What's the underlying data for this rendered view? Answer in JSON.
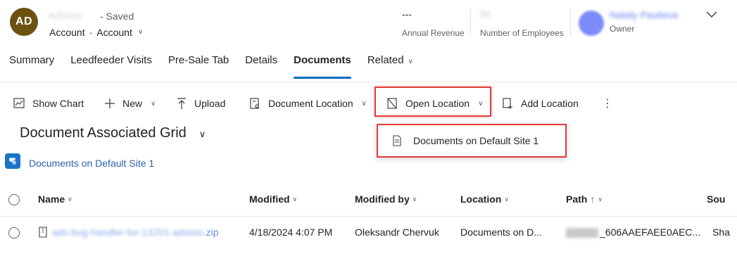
{
  "header": {
    "avatar_initials": "AD",
    "record_name": "Advisio",
    "saved_status": "- Saved",
    "entity_type": "Account",
    "entity_dot": "·",
    "form_name": "Account",
    "annual_revenue": {
      "value": "---",
      "label": "Annual Revenue"
    },
    "employees": {
      "value": "50",
      "label": "Number of Employees"
    },
    "owner": {
      "name": "Nataly Paulieva",
      "label": "Owner"
    }
  },
  "tabs": [
    {
      "label": "Summary",
      "active": false
    },
    {
      "label": "Leedfeeder Visits",
      "active": false
    },
    {
      "label": "Pre-Sale Tab",
      "active": false
    },
    {
      "label": "Details",
      "active": false
    },
    {
      "label": "Documents",
      "active": true
    },
    {
      "label": "Related",
      "active": false
    }
  ],
  "commands": {
    "show_chart": "Show Chart",
    "new": "New",
    "upload": "Upload",
    "document_location": "Document Location",
    "open_location": "Open Location",
    "add_location": "Add Location",
    "more": "⋮"
  },
  "flyout": {
    "item": "Documents on Default Site 1"
  },
  "grid": {
    "title": "Document Associated Grid",
    "site_link": "Documents on Default Site 1",
    "columns": [
      "Name",
      "Modified",
      "Modified by",
      "Location",
      "Path",
      "Sou"
    ],
    "sort_arrow": "↑",
    "rows": [
      {
        "name_blurred": "ads-bug-handler-for-13201-advisio",
        "name_ext": ".zip",
        "modified": "4/18/2024 4:07 PM",
        "modified_by": "Oleksandr Chervuk",
        "location": "Documents on D...",
        "path": "_606AAEFAEE0AEC...",
        "source": "Sha"
      }
    ]
  },
  "colors": {
    "accent": "#0f6cbd",
    "highlight": "#e53b3b",
    "avatar": "#6b5210",
    "link": "#2b63ad"
  }
}
